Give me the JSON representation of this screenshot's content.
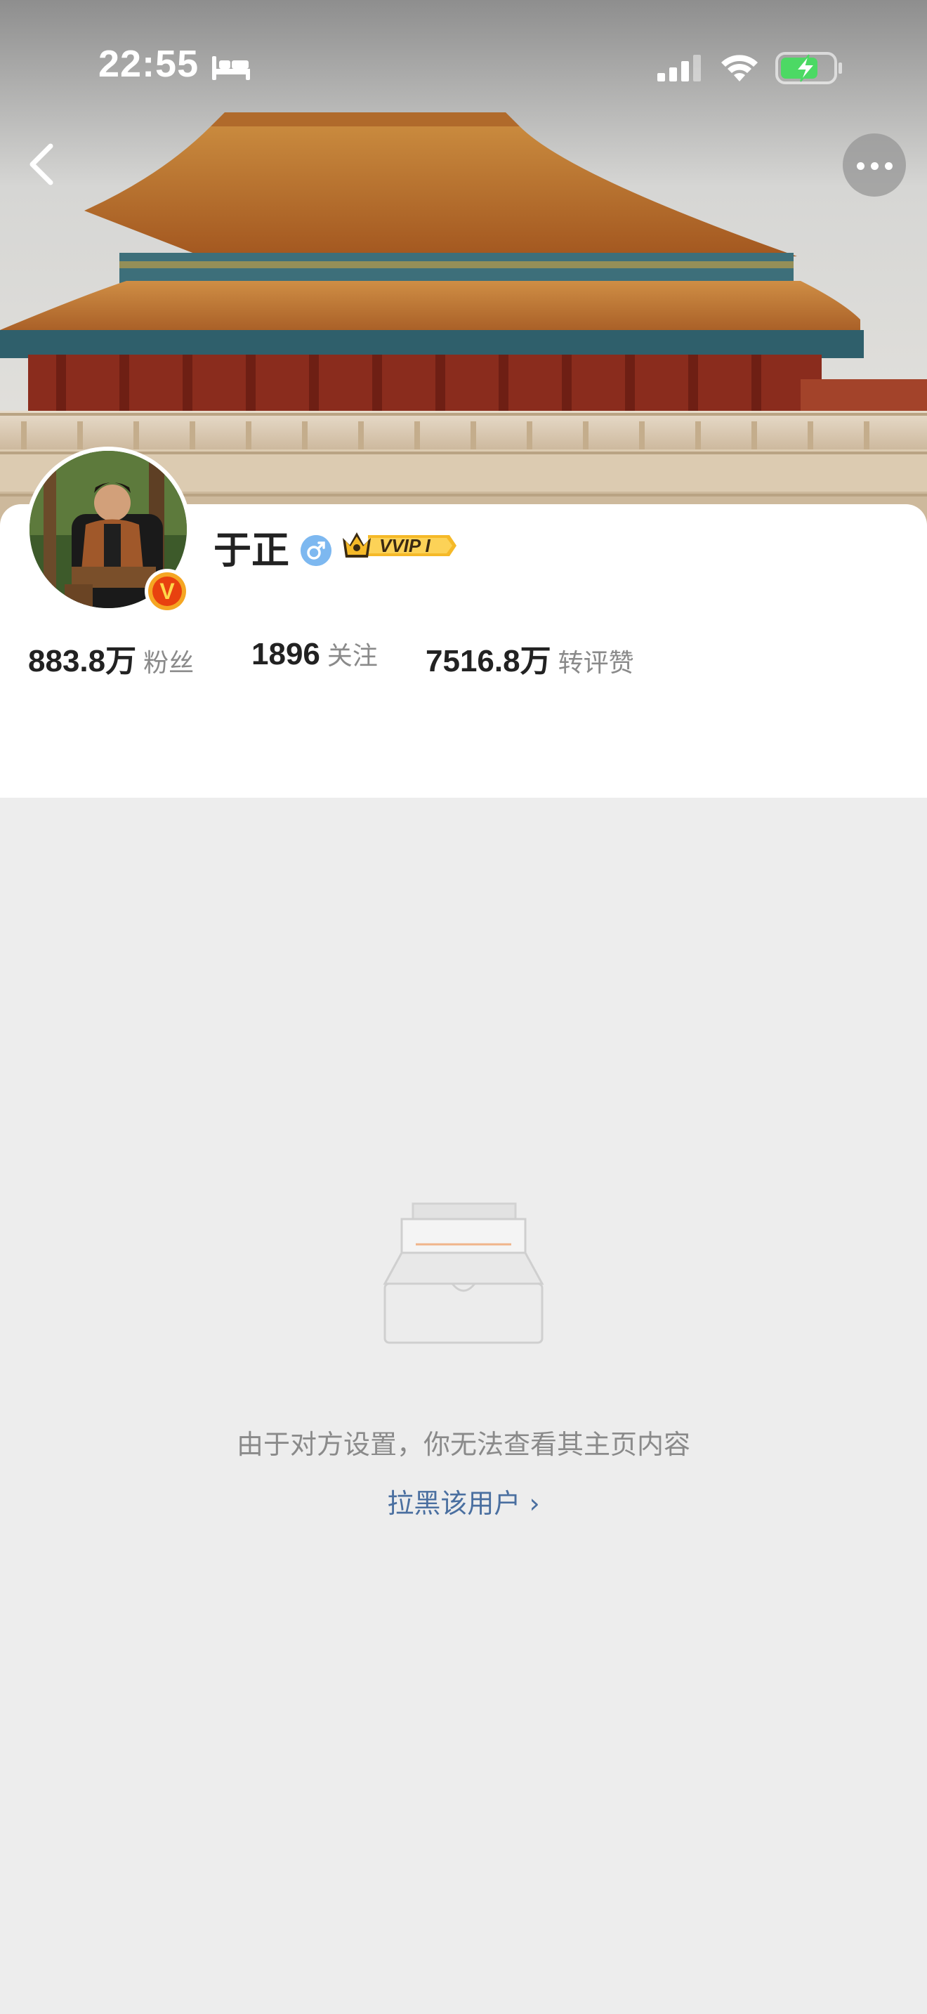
{
  "status_bar": {
    "time": "22:55",
    "sleep_icon": "bed-icon",
    "signal_icon": "cellular-signal-icon",
    "wifi_icon": "wifi-icon",
    "battery_icon": "battery-charging-icon",
    "battery_color": "#4cd964"
  },
  "nav": {
    "back_icon": "chevron-left-icon",
    "more_icon": "more-horizontal-icon"
  },
  "banner": {
    "image": "forbidden-city-hall-photo"
  },
  "profile": {
    "name": "于正",
    "gender_icon": "male-icon",
    "vip_label": "VVIP I",
    "verified_mark": "V",
    "stats": [
      {
        "value_num": "883.8",
        "value_unit": "万",
        "label": "粉丝"
      },
      {
        "value_num": "1896",
        "value_unit": "",
        "label": "关注"
      },
      {
        "value_num": "7516.8",
        "value_unit": "万",
        "label": "转评赞"
      }
    ]
  },
  "empty_state": {
    "illustration": "empty-inbox-icon",
    "message": "由于对方设置，你无法查看其主页内容",
    "block_link": "拉黑该用户 ›"
  },
  "colors": {
    "background": "#ededed",
    "link": "#4a6fa0",
    "gender": "#7db8f0",
    "vip_gold": "#f5b928"
  }
}
